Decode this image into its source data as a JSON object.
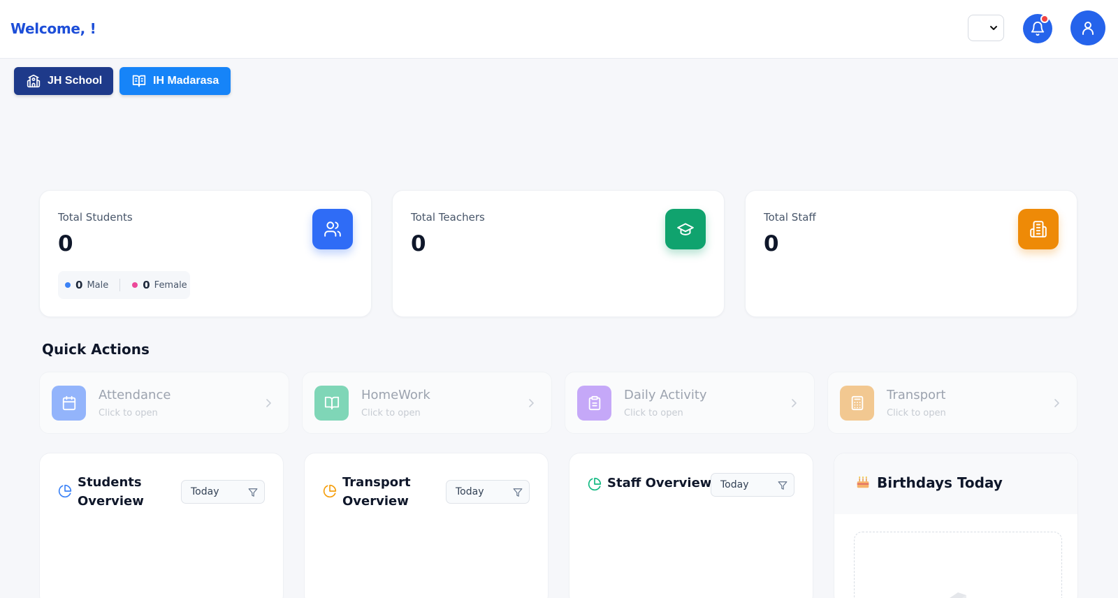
{
  "header": {
    "welcome": "Welcome, !"
  },
  "schools": [
    {
      "label": "JH School",
      "color": "#1e3a8a"
    },
    {
      "label": "IH Madarasa",
      "color": "#1684f8"
    }
  ],
  "stats": [
    {
      "label": "Total Students",
      "value": "0",
      "icon": "users-icon",
      "color": "#2f6cf6"
    },
    {
      "label": "Total Teachers",
      "value": "0",
      "icon": "graduation-cap-icon",
      "color": "#10a36e"
    },
    {
      "label": "Total Staff",
      "value": "0",
      "icon": "building-icon",
      "color": "#ee8a07"
    }
  ],
  "gender": {
    "male_count": "0",
    "male_label": "Male",
    "female_count": "0",
    "female_label": "Female"
  },
  "quick_actions": {
    "title": "Quick Actions",
    "items": [
      {
        "title": "Attendance",
        "subtitle": "Click to open",
        "icon": "calendar-icon",
        "color": "#93b4fb"
      },
      {
        "title": "HomeWork",
        "subtitle": "Click to open",
        "icon": "book-open-icon",
        "color": "#7fd6b7"
      },
      {
        "title": "Daily Activity",
        "subtitle": "Click to open",
        "icon": "clipboard-icon",
        "color": "#c5a8f8"
      },
      {
        "title": "Transport",
        "subtitle": "Click to open",
        "icon": "calculator-icon",
        "color": "#f2c891"
      }
    ]
  },
  "panels": {
    "students": {
      "title_line1": "Students",
      "title_line2": "Overview",
      "filter": "Today"
    },
    "transport": {
      "title_line1": "Transport",
      "title_line2": "Overview",
      "filter": "Today"
    },
    "staff": {
      "title": "Staff Overview",
      "filter": "Today"
    },
    "birthdays": {
      "title": "Birthdays Today"
    }
  }
}
